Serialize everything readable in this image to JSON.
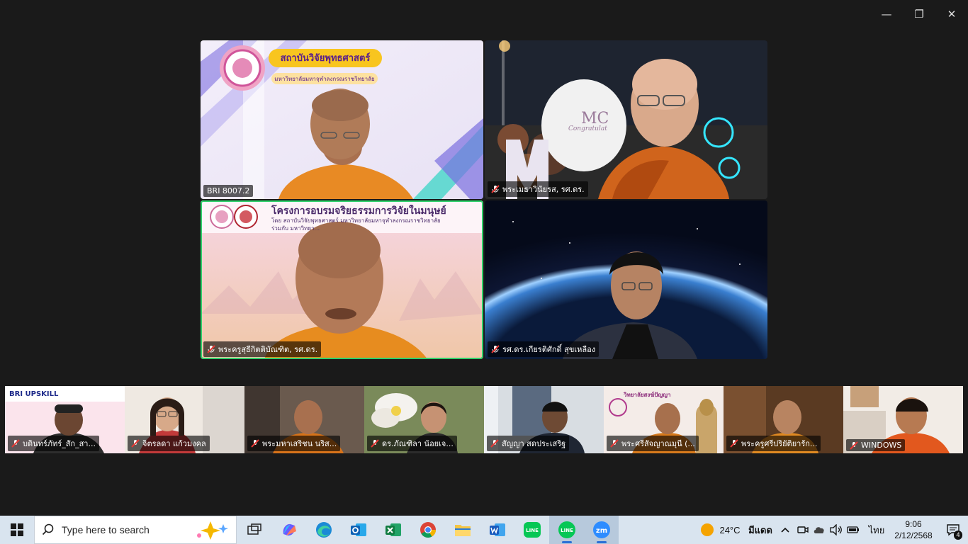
{
  "window": {
    "minimize": "—",
    "restore": "❐",
    "close": "✕"
  },
  "main_tiles": [
    {
      "name": "BRI 8007.2",
      "muted": false,
      "banner_title": "สถาบันวิจัยพุทธศาสตร์",
      "banner_subtitle": "มหาวิทยาลัยมหาจุฬาลงกรณราชวิทยาลัย"
    },
    {
      "name": "พระเมธาวินัยรส, รศ.ดร.",
      "muted": true,
      "sign_text": "MC",
      "sign_sub": "Congratulat"
    },
    {
      "name": "พระครูสุธีกิตติบัณฑิต, รศ.ดร.",
      "muted": true,
      "active": true,
      "banner_title": "โครงการอบรมจริยธรรมการวิจัยในมนุษย์",
      "banner_line1": "โดย สถาบันวิจัยพุทธศาสตร์ มหาวิทยาลัยมหาจุฬาลงกรณราชวิทยาลัย",
      "banner_line2": "ร่วมกับ มหาวิทยา..."
    },
    {
      "name": "รศ.ดร.เกียรติศักดิ์ สุขเหลือง",
      "muted": true
    }
  ],
  "thumbnails": [
    {
      "name": "บดินทร์ภัทร์_สัก_สา...",
      "muted": true,
      "banner": "BRI UPSKILL"
    },
    {
      "name": "จิตรลดา แก้วมงคล",
      "muted": true
    },
    {
      "name": "พระมหาเสริชน นริส...",
      "muted": true
    },
    {
      "name": "ดร.ภัณฑิลา น้อยเจ...",
      "muted": true
    },
    {
      "name": "สัญญา สดประเสริฐ",
      "muted": true
    },
    {
      "name": "พระศรีสัจญาณมุนี (...",
      "muted": true,
      "banner": "วิทยาลัยสงฆ์ปัญญา"
    },
    {
      "name": "พระครูศรีปริยัติยารัก...",
      "muted": true
    },
    {
      "name": "WINDOWS",
      "muted": true
    }
  ],
  "taskbar": {
    "search_placeholder": "Type here to search",
    "apps": [
      "task-view",
      "copilot",
      "edge",
      "outlook",
      "excel",
      "chrome",
      "file-explorer",
      "word",
      "line",
      "line",
      "zoom"
    ],
    "zoom_label": "zm",
    "weather_temp": "24°C",
    "weather_text": "มีแดด",
    "language": "ไทย",
    "time": "9:06",
    "date": "2/12/2568",
    "notification_count": "4",
    "line_label": "LINE"
  }
}
